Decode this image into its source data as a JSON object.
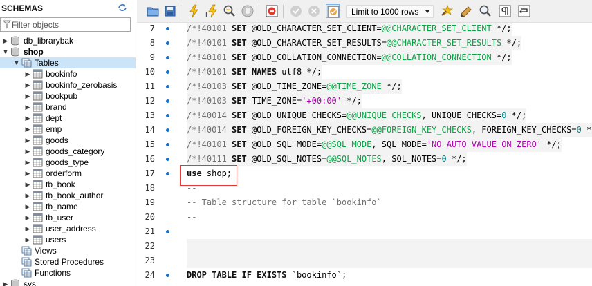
{
  "sidebar": {
    "title": "SCHEMAS",
    "filter_placeholder": "Filter objects",
    "tree": [
      {
        "label": "db_librarybak",
        "kind": "schema",
        "expanded": false
      },
      {
        "label": "shop",
        "kind": "schema",
        "expanded": true,
        "bold": true
      },
      {
        "label": "Tables",
        "kind": "folder",
        "expanded": true,
        "selected": true
      },
      {
        "label": "bookinfo",
        "kind": "table"
      },
      {
        "label": "bookinfo_zerobasis",
        "kind": "table"
      },
      {
        "label": "bookpub",
        "kind": "table"
      },
      {
        "label": "brand",
        "kind": "table"
      },
      {
        "label": "dept",
        "kind": "table"
      },
      {
        "label": "emp",
        "kind": "table"
      },
      {
        "label": "goods",
        "kind": "table"
      },
      {
        "label": "goods_category",
        "kind": "table"
      },
      {
        "label": "goods_type",
        "kind": "table"
      },
      {
        "label": "orderform",
        "kind": "table"
      },
      {
        "label": "tb_book",
        "kind": "table"
      },
      {
        "label": "tb_book_author",
        "kind": "table"
      },
      {
        "label": "tb_name",
        "kind": "table"
      },
      {
        "label": "tb_user",
        "kind": "table"
      },
      {
        "label": "user_address",
        "kind": "table"
      },
      {
        "label": "users",
        "kind": "table"
      },
      {
        "label": "Views",
        "kind": "folder"
      },
      {
        "label": "Stored Procedures",
        "kind": "folder"
      },
      {
        "label": "Functions",
        "kind": "folder"
      },
      {
        "label": "sys",
        "kind": "schema"
      }
    ]
  },
  "toolbar": {
    "limit_label": "Limit to 1000 rows",
    "buttons": [
      "open-file-icon",
      "save-icon",
      "execute-icon",
      "execute-current-icon",
      "explain-icon",
      "stop-icon",
      "toggle-error-icon",
      "commit-icon",
      "rollback-icon",
      "autocommit-icon",
      "beautify-icon",
      "find-icon",
      "invisible-chars-icon",
      "wrap-icon"
    ]
  },
  "editor": {
    "lines": [
      {
        "num": "7",
        "dot": true,
        "tokens": [
          [
            "/*!40101 ",
            "c"
          ],
          [
            "SET",
            "k"
          ],
          [
            " @OLD_CHARACTER_SET_CLIENT=",
            ""
          ],
          [
            "@@CHARACTER_SET_CLIENT",
            "v"
          ],
          [
            " */;",
            ""
          ]
        ]
      },
      {
        "num": "8",
        "dot": true,
        "tokens": [
          [
            "/*!40101 ",
            "c"
          ],
          [
            "SET",
            "k"
          ],
          [
            " @OLD_CHARACTER_SET_RESULTS=",
            ""
          ],
          [
            "@@CHARACTER_SET_RESULTS",
            "v"
          ],
          [
            " */;",
            ""
          ]
        ]
      },
      {
        "num": "9",
        "dot": true,
        "tokens": [
          [
            "/*!40101 ",
            "c"
          ],
          [
            "SET",
            "k"
          ],
          [
            " @OLD_COLLATION_CONNECTION=",
            ""
          ],
          [
            "@@COLLATION_CONNECTION",
            "v"
          ],
          [
            " */;",
            ""
          ]
        ]
      },
      {
        "num": "10",
        "dot": true,
        "tokens": [
          [
            "/*!40101 ",
            "c"
          ],
          [
            "SET",
            "k"
          ],
          [
            " ",
            ""
          ],
          [
            "NAMES",
            "k"
          ],
          [
            " utf8 */;",
            ""
          ]
        ]
      },
      {
        "num": "11",
        "dot": true,
        "tokens": [
          [
            "/*!40103 ",
            "c"
          ],
          [
            "SET",
            "k"
          ],
          [
            " @OLD_TIME_ZONE=",
            ""
          ],
          [
            "@@TIME_ZONE",
            "v"
          ],
          [
            " */;",
            ""
          ]
        ]
      },
      {
        "num": "12",
        "dot": true,
        "tokens": [
          [
            "/*!40103 ",
            "c"
          ],
          [
            "SET",
            "k"
          ],
          [
            " TIME_ZONE=",
            ""
          ],
          [
            "'+00:00'",
            "s"
          ],
          [
            " */;",
            ""
          ]
        ]
      },
      {
        "num": "13",
        "dot": true,
        "tokens": [
          [
            "/*!40014 ",
            "c"
          ],
          [
            "SET",
            "k"
          ],
          [
            " @OLD_UNIQUE_CHECKS=",
            ""
          ],
          [
            "@@UNIQUE_CHECKS",
            "v"
          ],
          [
            ", UNIQUE_CHECKS=",
            ""
          ],
          [
            "0",
            "n"
          ],
          [
            " */;",
            ""
          ]
        ]
      },
      {
        "num": "14",
        "dot": true,
        "tokens": [
          [
            "/*!40014 ",
            "c"
          ],
          [
            "SET",
            "k"
          ],
          [
            " @OLD_FOREIGN_KEY_CHECKS=",
            ""
          ],
          [
            "@@FOREIGN_KEY_CHECKS",
            "v"
          ],
          [
            ", FOREIGN_KEY_CHECKS=",
            ""
          ],
          [
            "0",
            "n"
          ],
          [
            " */;",
            ""
          ]
        ]
      },
      {
        "num": "15",
        "dot": true,
        "tokens": [
          [
            "/*!40101 ",
            "c"
          ],
          [
            "SET",
            "k"
          ],
          [
            " @OLD_SQL_MODE=",
            ""
          ],
          [
            "@@SQL_MODE",
            "v"
          ],
          [
            ", SQL_MODE=",
            ""
          ],
          [
            "'NO_AUTO_VALUE_ON_ZERO'",
            "s"
          ],
          [
            " */;",
            ""
          ]
        ]
      },
      {
        "num": "16",
        "dot": true,
        "tokens": [
          [
            "/*!40111 ",
            "c"
          ],
          [
            "SET",
            "k"
          ],
          [
            " @OLD_SQL_NOTES=",
            ""
          ],
          [
            "@@SQL_NOTES",
            "v"
          ],
          [
            ", SQL_NOTES=",
            ""
          ],
          [
            "0",
            "n"
          ],
          [
            " */;",
            ""
          ]
        ]
      },
      {
        "num": "17",
        "dot": true,
        "tokens": [
          [
            "use",
            "k"
          ],
          [
            " shop;",
            ""
          ]
        ]
      },
      {
        "num": "18",
        "dot": false,
        "tokens": [
          [
            "--",
            "c"
          ]
        ]
      },
      {
        "num": "19",
        "dot": false,
        "tokens": [
          [
            "-- Table structure for table `bookinfo`",
            "c"
          ]
        ]
      },
      {
        "num": "20",
        "dot": false,
        "tokens": [
          [
            "--",
            "c"
          ]
        ]
      },
      {
        "num": "21",
        "dot": true,
        "tokens": []
      },
      {
        "num": "22",
        "dot": false,
        "tokens": []
      },
      {
        "num": "23",
        "dot": false,
        "tokens": []
      },
      {
        "num": "24",
        "dot": true,
        "tokens": [
          [
            "DROP TABLE IF EXISTS",
            "k"
          ],
          [
            " `bookinfo`;",
            ""
          ]
        ]
      }
    ]
  }
}
